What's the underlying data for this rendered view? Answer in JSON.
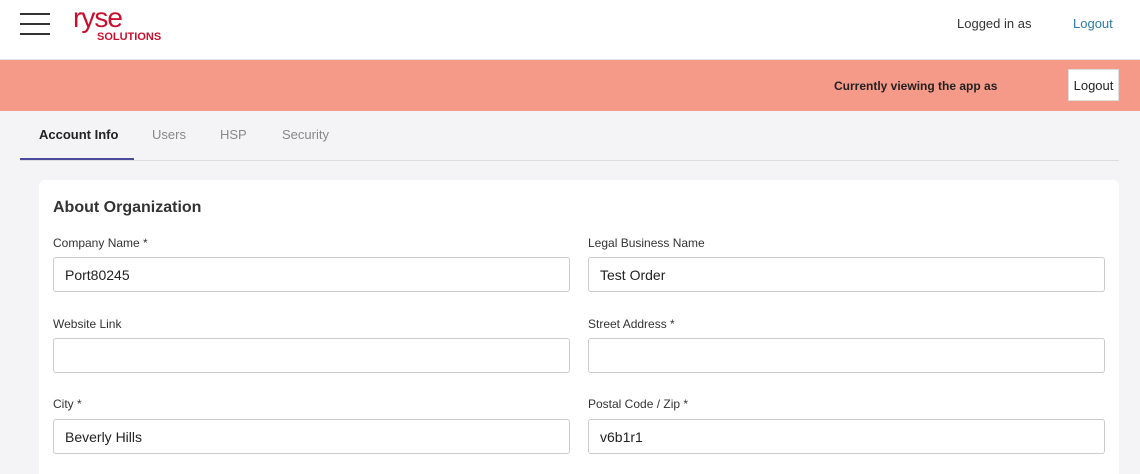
{
  "header": {
    "logo_text": "ryse",
    "logo_subtext": "SOLUTIONS",
    "logged_in_label": "Logged in as",
    "logout_label": "Logout"
  },
  "banner": {
    "text": "Currently viewing the app as",
    "logout_label": "Logout",
    "color": "#f59a88"
  },
  "tabs": [
    {
      "label": "Account Info",
      "active": true
    },
    {
      "label": "Users",
      "active": false
    },
    {
      "label": "HSP",
      "active": false
    },
    {
      "label": "Security",
      "active": false
    }
  ],
  "form": {
    "title": "About Organization",
    "fields": {
      "company_name": {
        "label": "Company Name *",
        "value": "Port80245"
      },
      "legal_business_name": {
        "label": "Legal Business Name",
        "value": "Test Order"
      },
      "website_link": {
        "label": "Website Link",
        "value": ""
      },
      "street_address": {
        "label": "Street Address *",
        "value": ""
      },
      "city": {
        "label": "City *",
        "value": "Beverly Hills"
      },
      "postal_code": {
        "label": "Postal Code / Zip *",
        "value": "v6b1r1"
      }
    }
  },
  "colors": {
    "brand": "#c8102e",
    "link": "#2c7aa6",
    "tab_active_underline": "#4b4b9c"
  }
}
